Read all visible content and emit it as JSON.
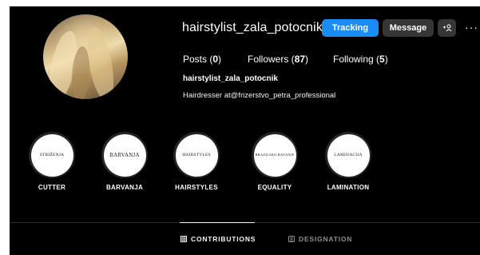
{
  "profile": {
    "username": "hairstylist_zala_potocnik",
    "buttons": {
      "tracking": "Tracking",
      "message": "Message",
      "add_person": "+⊙",
      "more": "···"
    },
    "stats": {
      "posts_label": "Posts (",
      "posts_value": "0",
      "posts_close": ")",
      "followers_label": "Followers (",
      "followers_value": "87",
      "followers_close": ")",
      "following_label": "Following (",
      "following_value": "5",
      "following_close": ")"
    },
    "bio_name": "hairstylist_zala_potocnik",
    "bio_text": "Hairdresser at@frizerstvo_petra_professional"
  },
  "highlights": [
    {
      "cover_text": "STRIŽENJA",
      "label": "CUTTER"
    },
    {
      "cover_text": "BARVANJA",
      "label": "BARVANJA"
    },
    {
      "cover_text": "HAIRSTYLES",
      "label": "HAIRSTYLES"
    },
    {
      "cover_text": "BRAZILSKO RAVANJE",
      "label": "EQUALITY"
    },
    {
      "cover_text": "LAMINACIJA",
      "label": "LAMINATION"
    }
  ],
  "tabs": {
    "contributions": "CONTRIBUTIONS",
    "designation": "DESIGNATION"
  },
  "colors": {
    "background": "#000000",
    "primary_button": "#1a8cf5",
    "secondary_button": "#363636"
  }
}
